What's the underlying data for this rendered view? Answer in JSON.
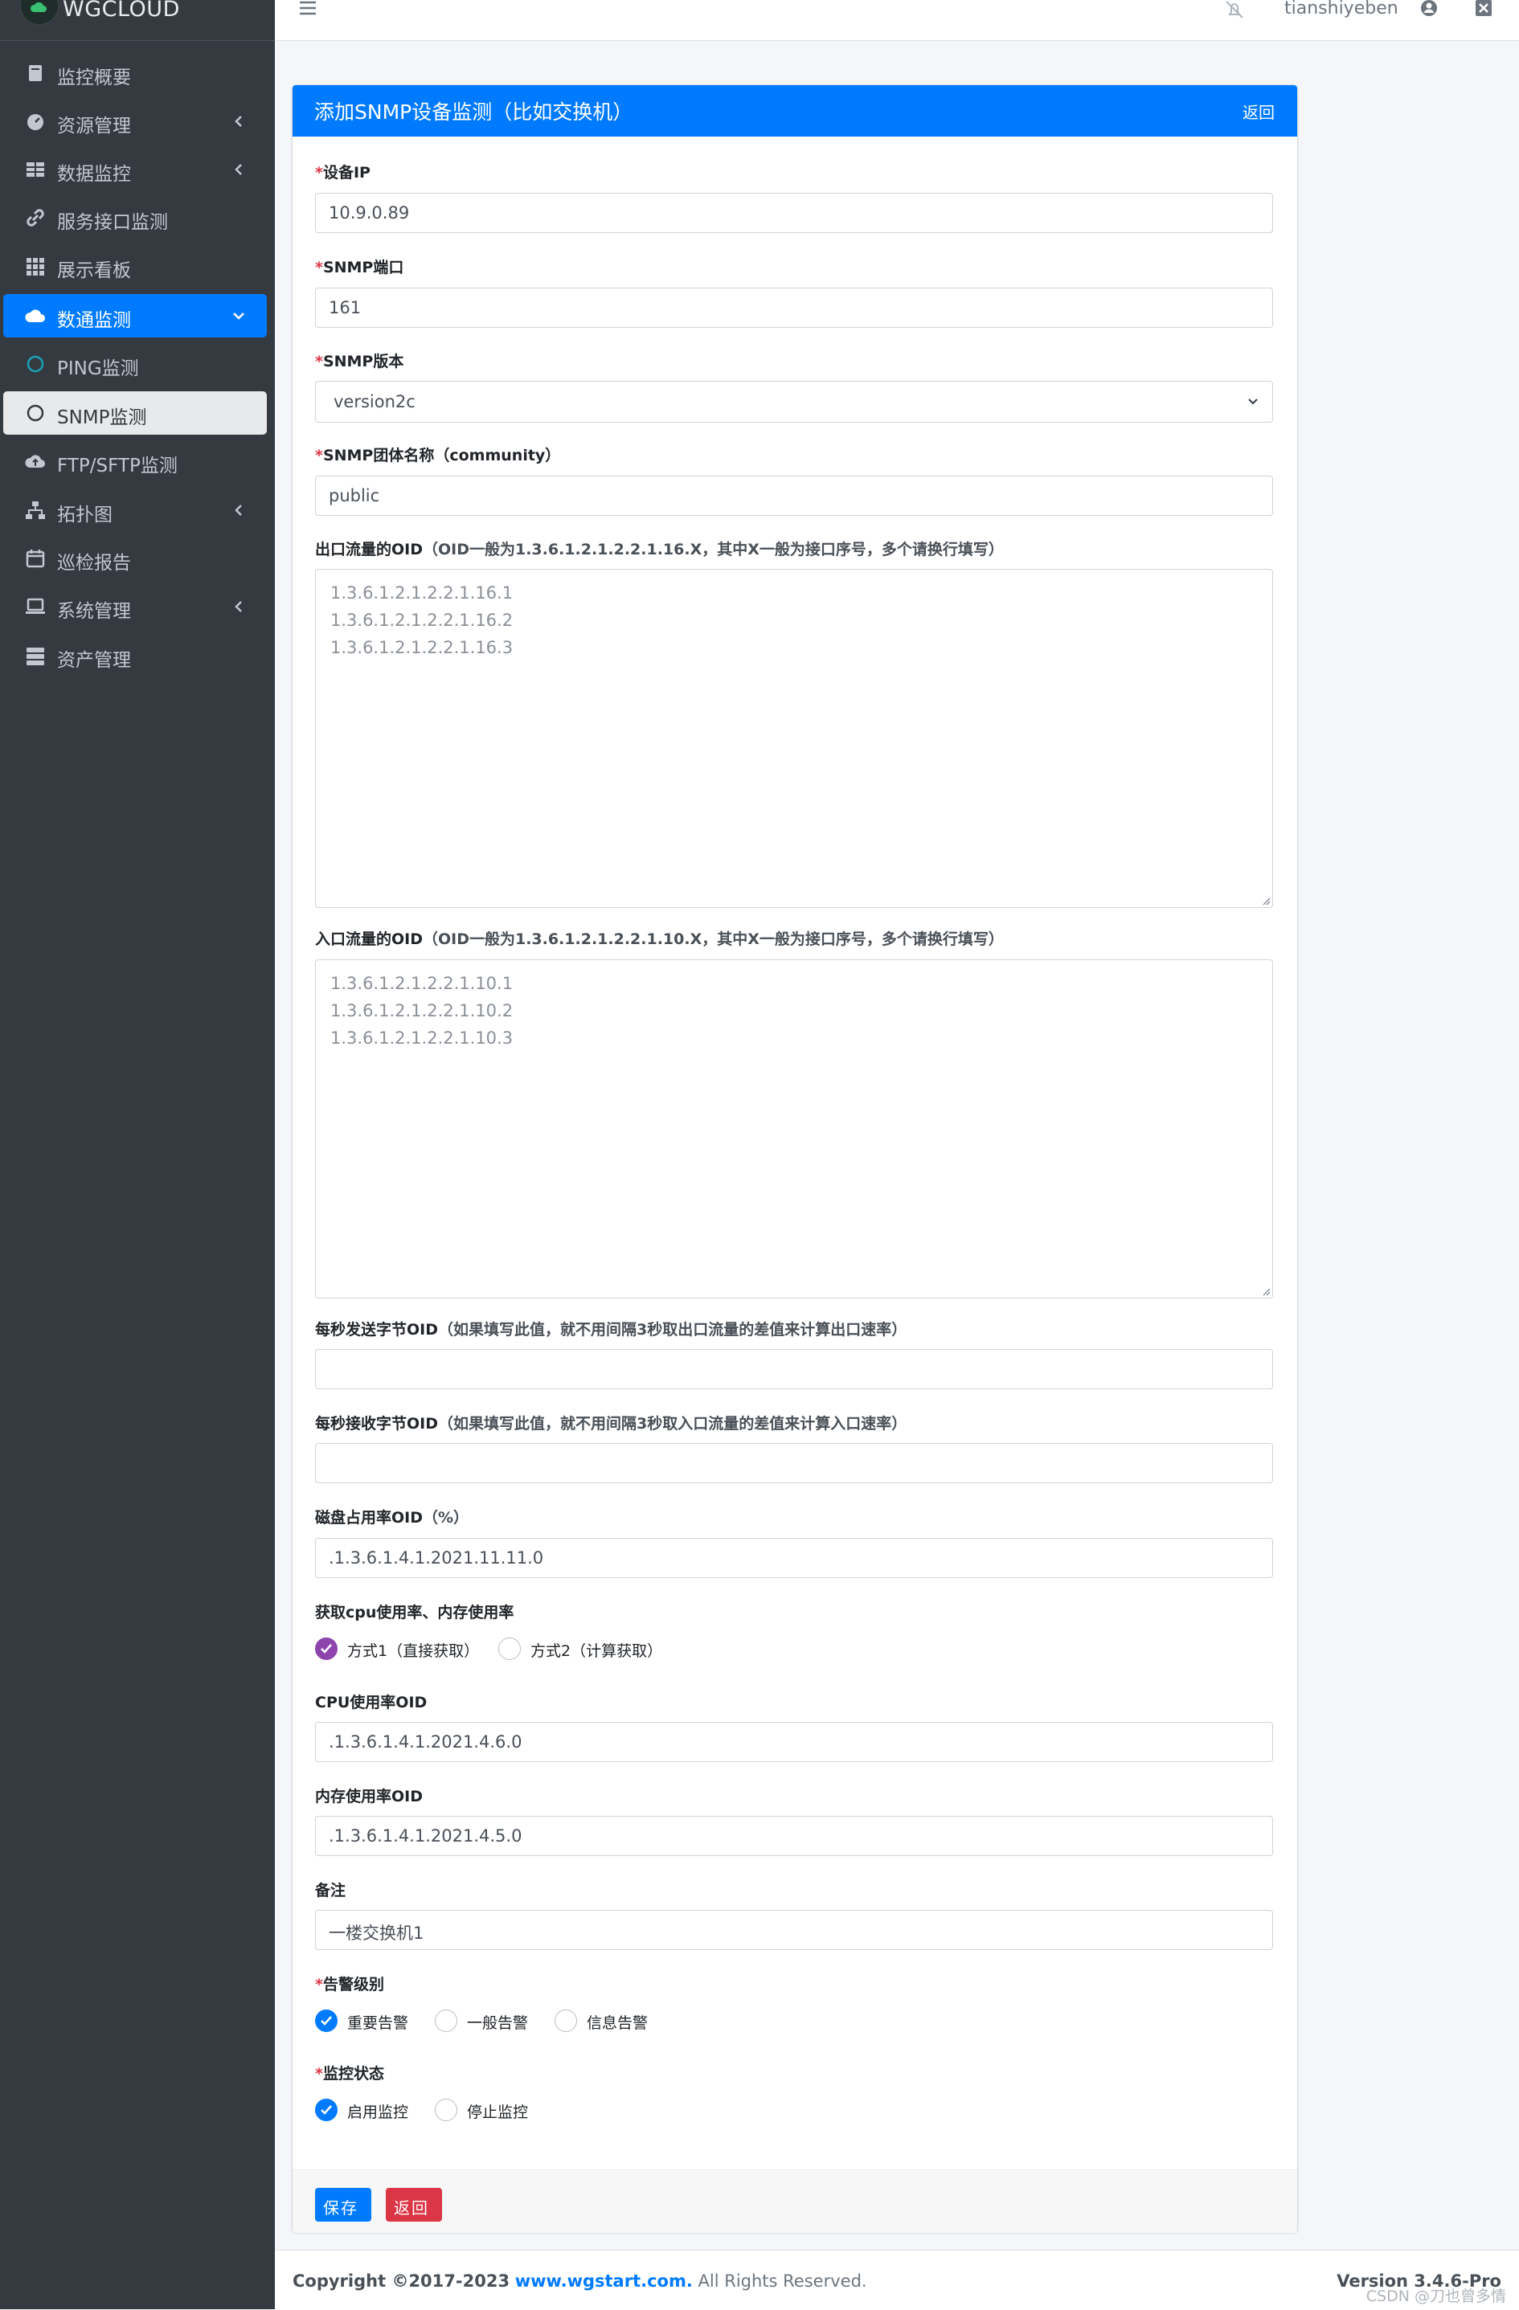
{
  "brand": {
    "name": "WGCLOUD"
  },
  "sidebar": {
    "items": [
      {
        "label": "监控概要",
        "icon": "book-icon"
      },
      {
        "label": "资源管理",
        "icon": "dashboard-icon"
      },
      {
        "label": "数据监控",
        "icon": "table-icon"
      },
      {
        "label": "服务接口监测",
        "icon": "link-icon"
      },
      {
        "label": "展示看板",
        "icon": "grid-icon"
      },
      {
        "label": "数通监测",
        "icon": "cloud-icon"
      },
      {
        "label": "PING监测",
        "icon": "circle-icon"
      },
      {
        "label": "SNMP监测",
        "icon": "circle-icon"
      },
      {
        "label": "FTP/SFTP监测",
        "icon": "cloud-upload-icon"
      },
      {
        "label": "拓扑图",
        "icon": "sitemap-icon"
      },
      {
        "label": "巡检报告",
        "icon": "calendar-icon"
      },
      {
        "label": "系统管理",
        "icon": "laptop-icon"
      },
      {
        "label": "资产管理",
        "icon": "server-icon"
      }
    ]
  },
  "topbar": {
    "username": "tianshiyeben"
  },
  "card": {
    "title": "添加SNMP设备监测（比如交换机）",
    "back_link": "返回"
  },
  "form": {
    "device_ip": {
      "label": "设备IP",
      "value": "10.9.0.89"
    },
    "snmp_port": {
      "label": "SNMP端口",
      "value": "161"
    },
    "snmp_version": {
      "label": "SNMP版本",
      "value": "version2c"
    },
    "community": {
      "label": "SNMP团体名称（community）",
      "value": "public"
    },
    "out_oid": {
      "label": "出口流量的OID",
      "hint": "（OID一般为1.3.6.1.2.1.2.2.1.16.X，其中X一般为接口序号，多个请换行填写）",
      "lines": [
        "1.3.6.1.2.1.2.2.1.16.1",
        "1.3.6.1.2.1.2.2.1.16.2",
        "1.3.6.1.2.1.2.2.1.16.3"
      ]
    },
    "in_oid": {
      "label": "入口流量的OID",
      "hint": "（OID一般为1.3.6.1.2.1.2.2.1.10.X，其中X一般为接口序号，多个请换行填写）",
      "lines": [
        "1.3.6.1.2.1.2.2.1.10.1",
        "1.3.6.1.2.1.2.2.1.10.2",
        "1.3.6.1.2.1.2.2.1.10.3"
      ]
    },
    "send_bytes_oid": {
      "label": "每秒发送字节OID",
      "hint": "（如果填写此值，就不用间隔3秒取出口流量的差值来计算出口速率）",
      "value": ""
    },
    "recv_bytes_oid": {
      "label": "每秒接收字节OID",
      "hint": "（如果填写此值，就不用间隔3秒取入口流量的差值来计算入口速率）",
      "value": ""
    },
    "disk_oid": {
      "label": "磁盘占用率OID",
      "hint": "（%）",
      "value": ".1.3.6.1.4.1.2021.11.11.0"
    },
    "cpu_mem_mode": {
      "label": "获取cpu使用率、内存使用率",
      "options": [
        "方式1（直接获取）",
        "方式2（计算获取）"
      ],
      "selected": 0
    },
    "cpu_oid": {
      "label": "CPU使用率OID",
      "value": ".1.3.6.1.4.1.2021.4.6.0"
    },
    "mem_oid": {
      "label": "内存使用率OID",
      "value": ".1.3.6.1.4.1.2021.4.5.0"
    },
    "remark": {
      "label": "备注",
      "value": "一楼交换机1"
    },
    "alarm_level": {
      "label": "告警级别",
      "options": [
        "重要告警",
        "一般告警",
        "信息告警"
      ],
      "selected": 0
    },
    "monitor_status": {
      "label": "监控状态",
      "options": [
        "启用监控",
        "停止监控"
      ],
      "selected": 0
    }
  },
  "buttons": {
    "save": "保存",
    "back": "返回"
  },
  "footer": {
    "copyright": "Copyright ©2017-2023",
    "site": "www.wgstart.com.",
    "rights": "All Rights Reserved.",
    "version": "Version 3.4.6-Pro",
    "watermark": "CSDN @刀也曾多情"
  },
  "colors": {
    "primary": "#007bff",
    "danger": "#dc3545",
    "sidebar": "#343a40",
    "purple": "#8e44ad"
  }
}
